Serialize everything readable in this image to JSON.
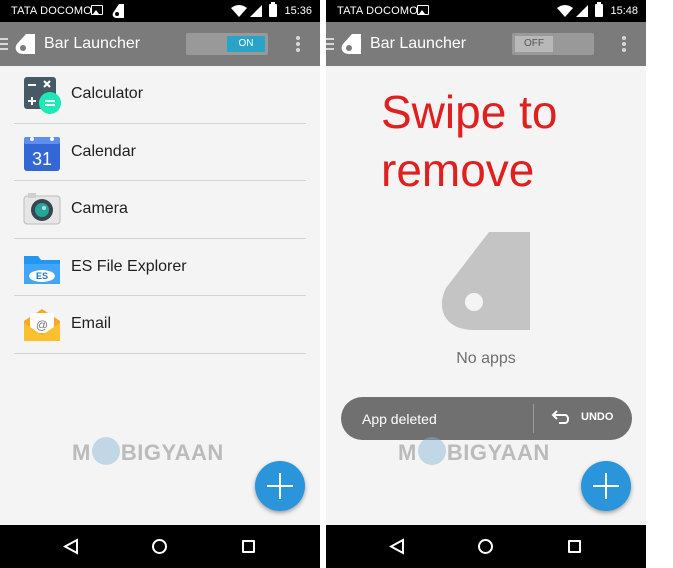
{
  "left_screen": {
    "status_bar": {
      "carrier": "TATA DOCOMO",
      "time": "15:36"
    },
    "app_bar": {
      "title": "Bar Launcher",
      "toggle_label": "ON"
    },
    "apps": [
      {
        "name": "Calculator",
        "icon": "calculator-icon"
      },
      {
        "name": "Calendar",
        "icon": "calendar-icon",
        "icon_text": "31"
      },
      {
        "name": "Camera",
        "icon": "camera-icon"
      },
      {
        "name": "ES File Explorer",
        "icon": "es-file-explorer-icon",
        "icon_text": "ES"
      },
      {
        "name": "Email",
        "icon": "email-icon",
        "icon_text": "@"
      }
    ],
    "watermark": {
      "pre": "M",
      "post": "BIGYAAN"
    }
  },
  "right_screen": {
    "status_bar": {
      "carrier": "TATA DOCOMO",
      "time": "15:48"
    },
    "app_bar": {
      "title": "Bar Launcher",
      "toggle_label": "OFF"
    },
    "overlay_line1": "Swipe to",
    "overlay_line2": "remove",
    "empty_label": "No apps",
    "snackbar": {
      "message": "App deleted",
      "action": "UNDO"
    },
    "watermark": {
      "pre": "M",
      "post": "BIGYAAN"
    }
  },
  "colors": {
    "app_bar": "#7b7b7b",
    "toggle_on": "#2aa3c8",
    "fab": "#2a95da",
    "overlay_text": "#e01f1f"
  }
}
